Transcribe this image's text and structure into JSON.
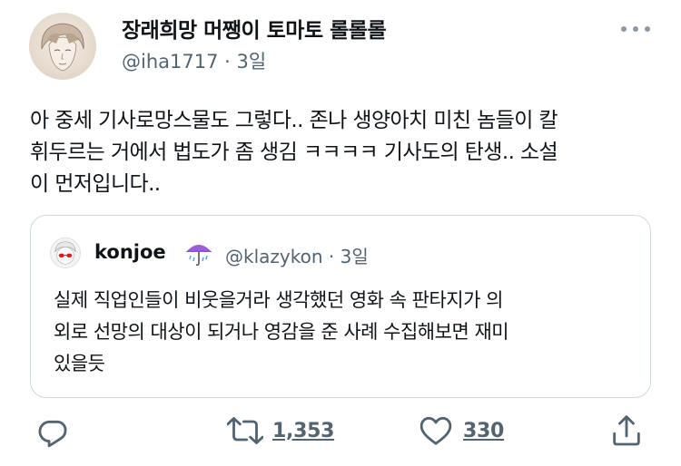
{
  "author": {
    "name": "장래희망 머쨍이 토마토 롤롤롤",
    "handle": "@iha1717",
    "time": "3일"
  },
  "separator": "·",
  "tweet_text": "아 중세 기사로망스물도 그렇다.. 존나 생양아치 미친 놈들이 칼\n휘두르는 거에서 법도가 좀 생김 ㅋㅋㅋㅋ 기사도의 탄생.. 소설\n이 먼저입니다..",
  "quote": {
    "name": "konjoe",
    "handle": "@klazykon",
    "time": "3일",
    "badge_icon": "umbrella-with-rain-icon",
    "text": "실제 직업인들이 비웃을거라 생각했던 영화 속 판타지가 의\n외로 선망의 대상이 되거나 영감을 준 사례 수집해보면 재미\n있을듯"
  },
  "actions": {
    "reply_icon": "reply-icon",
    "retweet_icon": "retweet-icon",
    "retweet_count": "1,353",
    "like_icon": "heart-icon",
    "like_count": "330",
    "share_icon": "share-icon"
  },
  "colors": {
    "text": "#0f1419",
    "secondary": "#536471",
    "border": "#cfd9de",
    "umbrella": "#9b5fd6"
  }
}
